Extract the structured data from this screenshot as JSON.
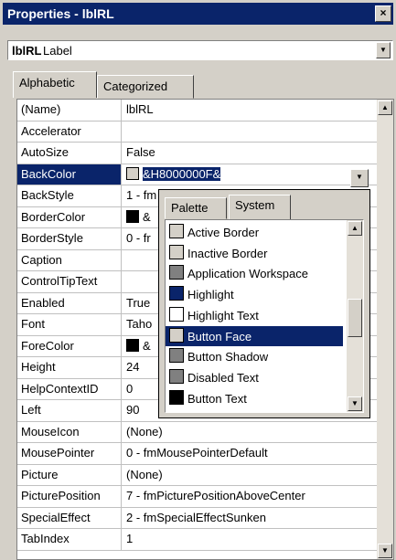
{
  "window": {
    "title": "Properties - lblRL",
    "close_glyph": "×"
  },
  "object_selector": {
    "name": "lblRL",
    "type": "Label"
  },
  "tabs": [
    {
      "label": "Alphabetic",
      "active": true
    },
    {
      "label": "Categorized",
      "active": false
    }
  ],
  "properties": [
    {
      "name": "(Name)",
      "value": "lblRL"
    },
    {
      "name": "Accelerator",
      "value": ""
    },
    {
      "name": "AutoSize",
      "value": "False"
    },
    {
      "name": "BackColor",
      "value": "&H8000000F&",
      "swatch": "#d4d0c8",
      "selected": true
    },
    {
      "name": "BackStyle",
      "value": "1 - fm"
    },
    {
      "name": "BorderColor",
      "value": "&",
      "swatch": "#000000"
    },
    {
      "name": "BorderStyle",
      "value": "0 - fr"
    },
    {
      "name": "Caption",
      "value": ""
    },
    {
      "name": "ControlTipText",
      "value": ""
    },
    {
      "name": "Enabled",
      "value": "True"
    },
    {
      "name": "Font",
      "value": "Taho"
    },
    {
      "name": "ForeColor",
      "value": "&",
      "swatch": "#000000"
    },
    {
      "name": "Height",
      "value": "24"
    },
    {
      "name": "HelpContextID",
      "value": "0"
    },
    {
      "name": "Left",
      "value": "90"
    },
    {
      "name": "MouseIcon",
      "value": "(None)"
    },
    {
      "name": "MousePointer",
      "value": "0 - fmMousePointerDefault"
    },
    {
      "name": "Picture",
      "value": "(None)"
    },
    {
      "name": "PicturePosition",
      "value": "7 - fmPicturePositionAboveCenter"
    },
    {
      "name": "SpecialEffect",
      "value": "2 - fmSpecialEffectSunken"
    },
    {
      "name": "TabIndex",
      "value": "1"
    }
  ],
  "color_popup": {
    "tabs": [
      {
        "label": "Palette",
        "active": false
      },
      {
        "label": "System",
        "active": true
      }
    ],
    "items": [
      {
        "label": "Active Border",
        "swatch": "#d4d0c8"
      },
      {
        "label": "Inactive Border",
        "swatch": "#d4d0c8"
      },
      {
        "label": "Application Workspace",
        "swatch": "#808080"
      },
      {
        "label": "Highlight",
        "swatch": "#0a246a"
      },
      {
        "label": "Highlight Text",
        "swatch": "#ffffff"
      },
      {
        "label": "Button Face",
        "swatch": "#d4d0c8",
        "selected": true
      },
      {
        "label": "Button Shadow",
        "swatch": "#808080"
      },
      {
        "label": "Disabled Text",
        "swatch": "#808080"
      },
      {
        "label": "Button Text",
        "swatch": "#000000"
      }
    ]
  },
  "colors": {
    "title_bar": "#0a246a",
    "selection": "#0a246a",
    "face": "#d4d0c8"
  },
  "icons": {
    "scroll_up": "scroll-up-arrow-icon",
    "scroll_down": "scroll-down-arrow-icon",
    "dropdown": "chevron-down-icon",
    "close": "close-icon"
  }
}
